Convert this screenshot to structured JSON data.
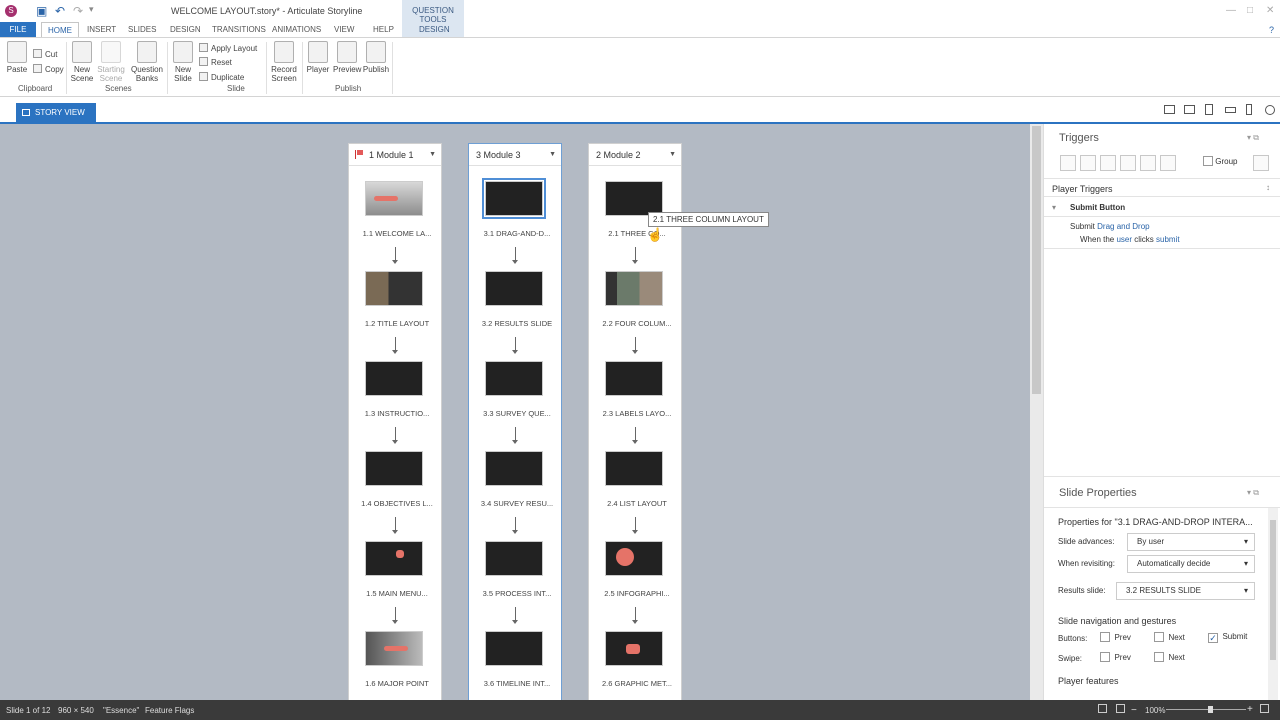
{
  "window": {
    "title": "WELCOME LAYOUT.story* - Articulate Storyline",
    "logo_text": "S",
    "undo": "↶",
    "redo": "↷",
    "save": "▣",
    "more": "▾",
    "minimize": "—",
    "restore": "□",
    "close": "✕",
    "help": "?"
  },
  "contextual_group": {
    "label": "QUESTION TOOLS",
    "tab": "DESIGN"
  },
  "tabs": [
    "FILE",
    "HOME",
    "INSERT",
    "SLIDES",
    "DESIGN",
    "TRANSITIONS",
    "ANIMATIONS",
    "VIEW",
    "HELP"
  ],
  "active_tab": "HOME",
  "ribbon": {
    "clipboard": {
      "paste": "Paste",
      "cut": "Cut",
      "copy": "Copy",
      "group": "Clipboard"
    },
    "scenes": {
      "new_scene": [
        "New",
        "Scene"
      ],
      "starting_scene": [
        "Starting",
        "Scene"
      ],
      "question_banks": [
        "Question",
        "Banks"
      ],
      "group": "Scenes"
    },
    "slide": {
      "new_slide": [
        "New",
        "Slide"
      ],
      "apply_layout": "Apply Layout",
      "reset": "Reset",
      "duplicate": "Duplicate",
      "group": "Slide"
    },
    "record": {
      "label": [
        "Record",
        "Screen"
      ]
    },
    "publish": {
      "player": "Player",
      "preview": "Preview",
      "publish": "Publish",
      "group": "Publish"
    }
  },
  "view": {
    "tab_label": "STORY VIEW"
  },
  "scenes": [
    {
      "title": "1 Module 1",
      "selected": false,
      "has_flag": true,
      "slides": [
        "1.1 WELCOME LA...",
        "1.2 TITLE LAYOUT",
        "1.3 INSTRUCTIO...",
        "1.4 OBJECTIVES L...",
        "1.5 MAIN MENU...",
        "1.6 MAJOR POINT"
      ]
    },
    {
      "title": "3 Module 3",
      "selected": true,
      "has_flag": false,
      "slides": [
        "3.1  DRAG-AND-D...",
        "3.2 RESULTS SLIDE",
        "3.3 SURVEY QUE...",
        "3.4 SURVEY RESU...",
        "3.5 PROCESS INT...",
        "3.6 TIMELINE INT..."
      ]
    },
    {
      "title": "2 Module 2",
      "selected": false,
      "has_flag": false,
      "slides": [
        "2.1 THREE CO...",
        "2.2 FOUR COLUM...",
        "2.3  LABELS  LAYO...",
        "2.4 LIST LAYOUT",
        "2.5  INFOGRAPHI...",
        "2.6 GRAPHIC MET..."
      ]
    }
  ],
  "tooltip": "2.1 THREE COLUMN LAYOUT",
  "triggers": {
    "title": "Triggers",
    "group_label": "Group",
    "section": "Player Triggers",
    "item": "Submit Button",
    "action_prefix": "Submit ",
    "action_link": "Drag and Drop",
    "condition_prefix": "When the ",
    "condition_user": "user",
    "condition_mid": " clicks ",
    "condition_link": "submit"
  },
  "slide_properties": {
    "title": "Slide Properties",
    "heading": "Properties for \"3.1 DRAG-AND-DROP INTERA...",
    "slide_advances_label": "Slide advances:",
    "slide_advances": "By user",
    "revisiting_label": "When revisiting:",
    "revisiting": "Automatically decide",
    "results_label": "Results slide:",
    "results": "3.2 RESULTS SLIDE",
    "nav_heading": "Slide navigation and gestures",
    "buttons_label": "Buttons:",
    "swipe_label": "Swipe:",
    "prev": "Prev",
    "next": "Next",
    "submit": "Submit",
    "submit_checked": true,
    "player_features": "Player features"
  },
  "status": {
    "slide": "Slide 1 of 12",
    "size": "960 × 540",
    "theme": "\"Essence\"",
    "flags": "Feature Flags",
    "zoom": "100%",
    "zoom_out": "−",
    "zoom_in": "+"
  },
  "colors": {
    "accent": "#2b73c1",
    "canvas": "#b3bac4",
    "statusbar": "#3a3a3a"
  }
}
